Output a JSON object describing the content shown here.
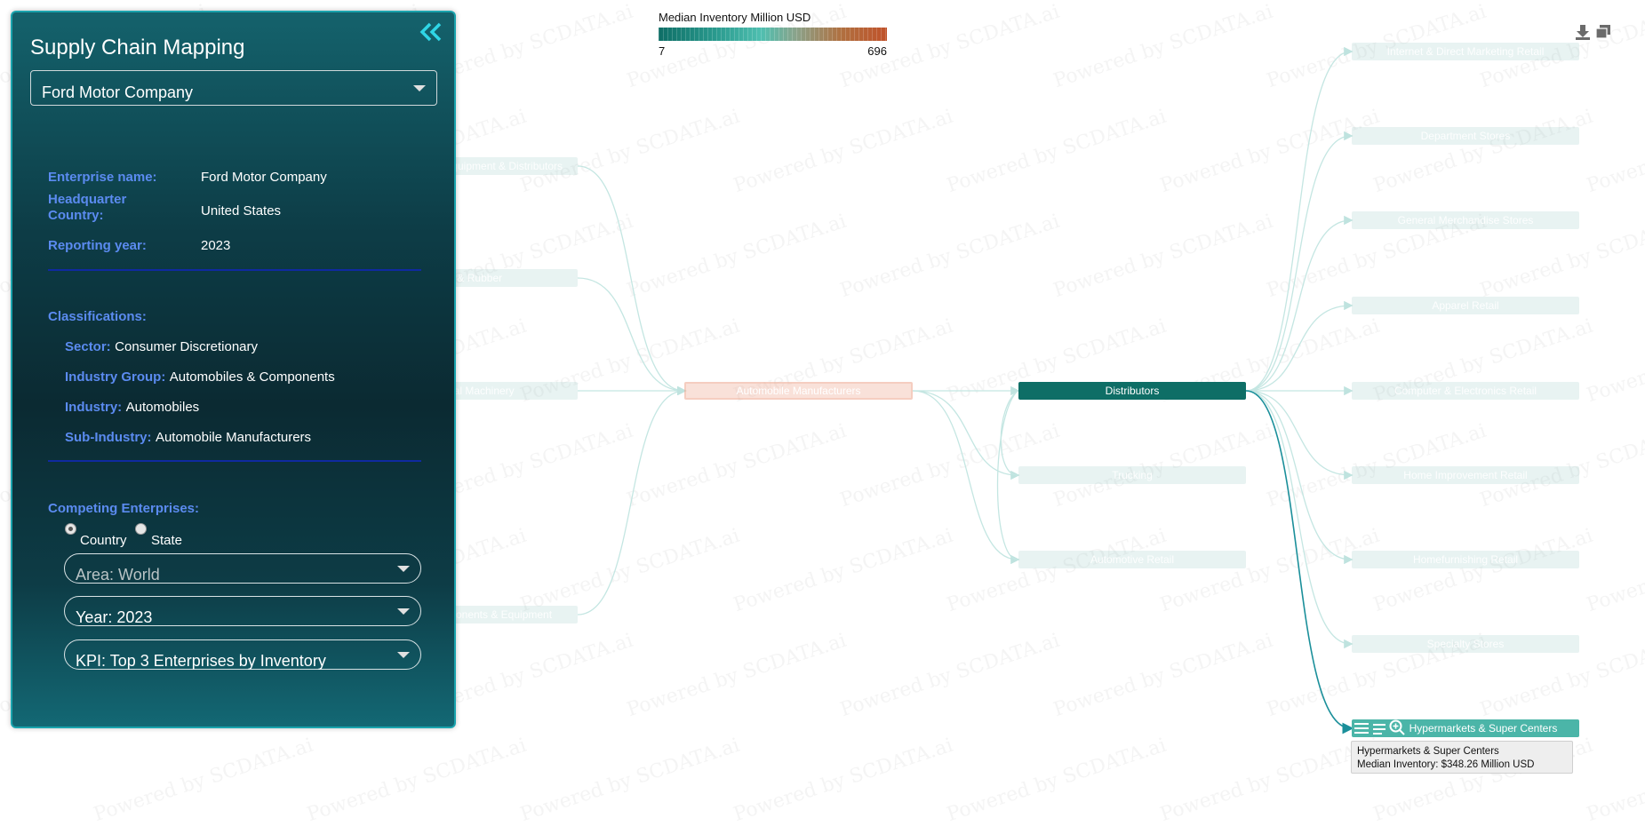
{
  "watermark_text": "Powered by SCDATA.ai",
  "legend": {
    "title": "Median Inventory Million USD",
    "min": "7",
    "max": "696"
  },
  "toolbar": {
    "download_icon": "download-icon",
    "copy_icon": "copy-icon"
  },
  "nodes": {
    "supplier_1": "Semiconductor Equipment & Distributors",
    "supplier_2": "Tires & Rubber",
    "supplier_3": "Industrial Machinery",
    "supplier_4": "Electrical Components & Equipment",
    "center": "Automobile Manufacturers",
    "distributors": "Distributors",
    "trucking": "Trucking",
    "automotive_retail": "Automotive Retail",
    "c_internet": "Internet & Direct Marketing Retail",
    "c_department": "Department Stores",
    "c_general": "General Merchandise Stores",
    "c_apparel": "Apparel Retail",
    "c_computer": "Computer & Electronics Retail",
    "c_home_improvement": "Home Improvement Retail",
    "c_homefurnishing": "Homefurnishing Retail",
    "c_specialty": "Specialty Stores",
    "c_hypermarkets": "Hypermarkets & Super Centers"
  },
  "tooltip": {
    "name": "Hypermarkets & Super Centers",
    "line": "Median Inventory: $348.26 Million USD"
  },
  "panel": {
    "title": "Supply Chain Mapping",
    "company_selected": "Ford Motor Company",
    "enterprise_name_label": "Enterprise name:",
    "enterprise_name": "Ford Motor Company",
    "hq_label_1": "Headquarter",
    "hq_label_2": "Country:",
    "hq_country": "United States",
    "reporting_year_label": "Reporting year:",
    "reporting_year": "2023",
    "classifications_label": "Classifications:",
    "sector_label": "Sector:",
    "sector": "Consumer Discretionary",
    "industry_group_label": "Industry Group:",
    "industry_group": "Automobiles & Components",
    "industry_label": "Industry:",
    "industry": "Automobiles",
    "sub_industry_label": "Sub-Industry:",
    "sub_industry": "Automobile Manufacturers",
    "competing_label": "Competing Enterprises:",
    "radio_country": "Country",
    "radio_state": "State",
    "area": "Area: World",
    "year": "Year: 2023",
    "kpi": "KPI: Top 3 Enterprises by Inventory"
  }
}
